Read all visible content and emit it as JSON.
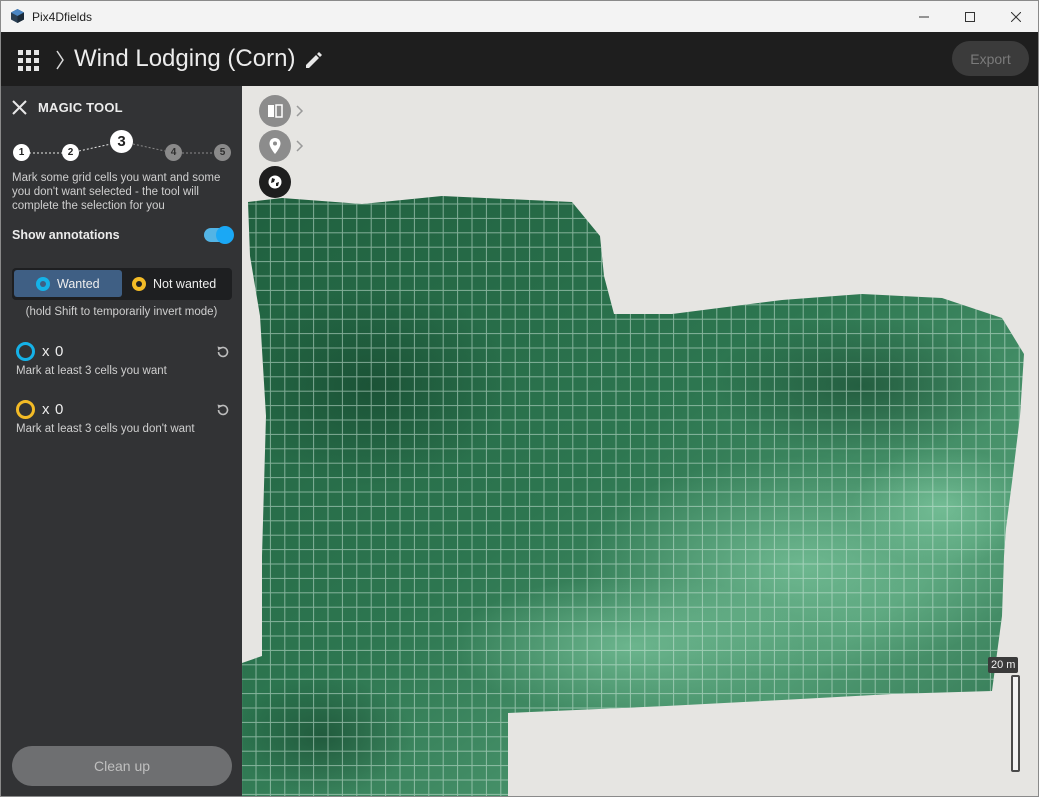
{
  "window": {
    "title": "Pix4Dfields",
    "controls": [
      "minimize-icon",
      "maximize-icon",
      "close-icon"
    ]
  },
  "header": {
    "project_title": "Wind Lodging (Corn)",
    "export_label": "Export",
    "icons": [
      "apps-grid-icon",
      "chevron-right-icon",
      "pencil-edit-icon"
    ]
  },
  "panel": {
    "title": "MAGIC TOOL",
    "steps": [
      {
        "label": "1",
        "state": "done"
      },
      {
        "label": "2",
        "state": "done"
      },
      {
        "label": "3",
        "state": "current"
      },
      {
        "label": "4",
        "state": "todo"
      },
      {
        "label": "5",
        "state": "todo"
      }
    ],
    "instructions": "Mark some grid cells you want and some you don't want selected - the tool will complete the selection for you",
    "show_annotations_label": "Show annotations",
    "show_annotations_on": true,
    "mode": {
      "wanted_label": "Wanted",
      "not_wanted_label": "Not wanted",
      "selected": "Wanted"
    },
    "shift_hint": "(hold Shift to temporarily invert mode)",
    "wanted_count": {
      "x": "x",
      "value": "0",
      "hint": "Mark at least 3 cells you want"
    },
    "not_wanted_count": {
      "x": "x",
      "value": "0",
      "hint": "Mark at least 3 cells you don't want"
    },
    "cleanup_label": "Clean up"
  },
  "map": {
    "tools": [
      "split-view-icon",
      "location-pin-icon",
      "globe-icon"
    ],
    "scale_label": "20 m"
  },
  "colors": {
    "accent_blue": "#15b2e8",
    "accent_yellow": "#f3bb26",
    "panel_bg": "#323335",
    "header_bg": "#1e1e1e",
    "wanted_bg": "#3f5f84",
    "field_green": "#2e7a55"
  }
}
